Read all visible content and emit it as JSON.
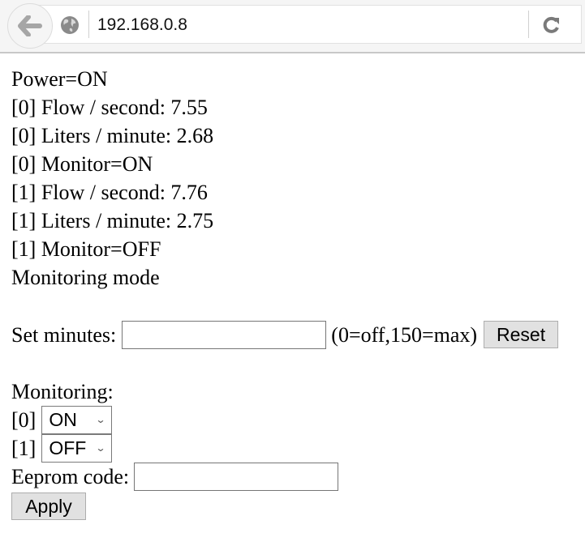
{
  "browser": {
    "url": "192.168.0.8",
    "icons": {
      "back": "back-arrow-icon",
      "site": "globe-icon",
      "reload": "reload-icon"
    }
  },
  "status": {
    "power": "Power=ON",
    "lines": [
      "[0] Flow / second: 7.55",
      "[0] Liters / minute: 2.68",
      "[0] Monitor=ON",
      "[1] Flow / second: 7.76",
      "[1] Liters / minute: 2.75",
      "[1] Monitor=OFF"
    ],
    "mode": "Monitoring mode"
  },
  "timer": {
    "label": "Set minutes:",
    "value": "",
    "hint": "(0=off,150=max)",
    "reset_label": "Reset"
  },
  "monitoring": {
    "heading": "Monitoring:",
    "channels": [
      {
        "label": "[0]",
        "selected": "ON"
      },
      {
        "label": "[1]",
        "selected": "OFF"
      }
    ]
  },
  "eeprom": {
    "label": "Eeprom code:",
    "value": ""
  },
  "apply_label": "Apply"
}
